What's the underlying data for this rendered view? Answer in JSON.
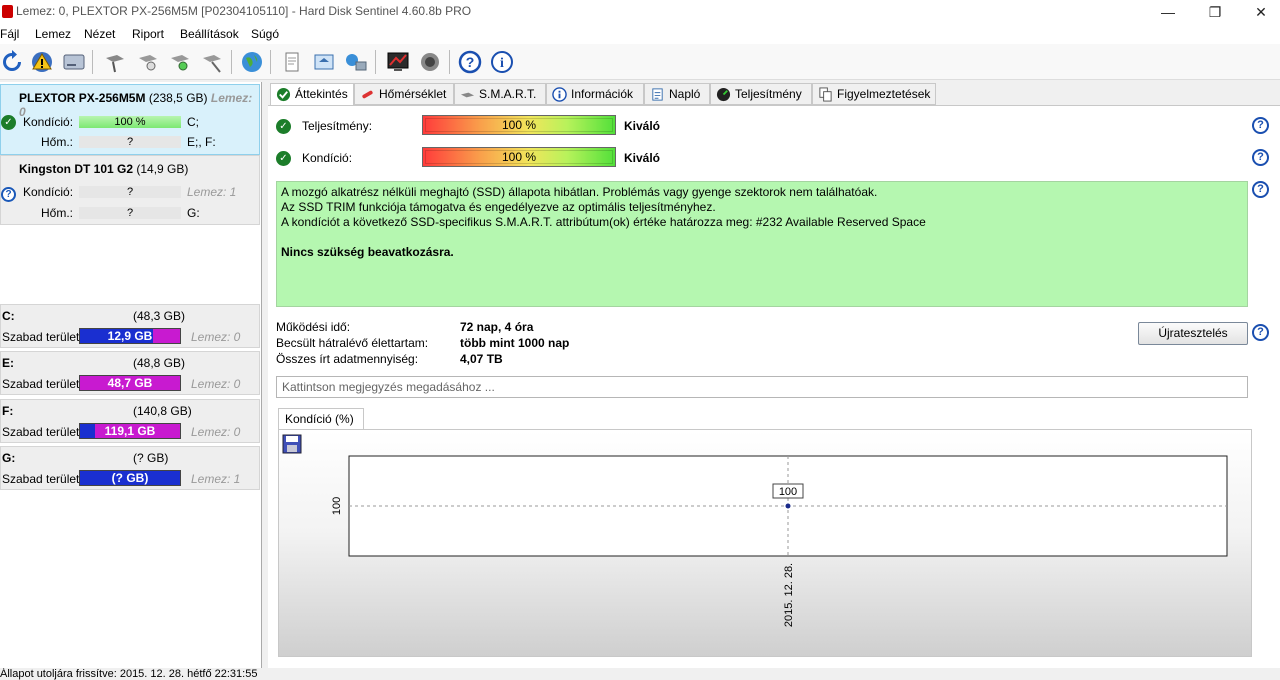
{
  "window": {
    "title": "Lemez: 0, PLEXTOR PX-256M5M [P02304105110]  -  Hard Disk Sentinel 4.60.8b PRO",
    "minimize": "—",
    "maximize": "❐",
    "close": "✕"
  },
  "menu": [
    "Fájl",
    "Lemez",
    "Nézet",
    "Riport",
    "Beállítások",
    "Súgó"
  ],
  "disks": [
    {
      "name": "PLEXTOR PX-256M5M",
      "size": "(238,5 GB)",
      "lemez": "Lemez: 0",
      "health_label": "Kondíció:",
      "health_value": "100 %",
      "health_fill": 100,
      "health_drives": "C;",
      "temp_label": "Hőm.:",
      "temp_value": "?",
      "temp_drives": "E;, F:"
    },
    {
      "name": "Kingston DT 101 G2",
      "size": "(14,9 GB)",
      "lemez": "Lemez: 1",
      "health_label": "Kondíció:",
      "health_value": "?",
      "temp_label": "Hőm.:",
      "temp_value": "?",
      "temp_drives": "G:"
    }
  ],
  "partitions": [
    {
      "name": "C:",
      "size": "(48,3 GB)",
      "label": "Szabad terület",
      "free": "12,9 GB",
      "lemez": "Lemez: 0",
      "color": "#1a2fd0"
    },
    {
      "name": "E:",
      "size": "(48,8 GB)",
      "label": "Szabad terület",
      "free": "48,7 GB",
      "lemez": "Lemez: 0",
      "color": "#c81ad0"
    },
    {
      "name": "F:",
      "size": "(140,8 GB)",
      "label": "Szabad terület",
      "free": "119,1 GB",
      "lemez": "Lemez: 0",
      "color": "#c81ad0"
    },
    {
      "name": "G:",
      "size": "(? GB)",
      "label": "Szabad terület",
      "free": "(? GB)",
      "lemez": "Lemez: 1",
      "color": "#1a2fd0"
    }
  ],
  "tabs": [
    "Áttekintés",
    "Hőmérséklet",
    "S.M.A.R.T.",
    "Információk",
    "Napló",
    "Teljesítmény",
    "Figyelmeztetések"
  ],
  "overview": {
    "perf_label": "Teljesítmény:",
    "perf_value": "100 %",
    "perf_text": "Kiváló",
    "health_label": "Kondíció:",
    "health_value": "100 %",
    "health_text": "Kiváló",
    "message_lines": [
      "A mozgó alkatrész nélküli meghajtó (SSD) állapota hibátlan. Problémás vagy gyenge szektorok nem találhatóak.",
      "Az SSD TRIM funkciója támogatva és engedélyezve az optimális teljesítményhez.",
      "A kondíciót a következő SSD-specifikus S.M.A.R.T. attribútum(ok) értéke határozza meg:  #232 Available Reserved Space"
    ],
    "message_action": "Nincs szükség beavatkozásra.",
    "uptime_label": "Működési idő:",
    "uptime_value": "72 nap, 4 óra",
    "remaining_label": "Becsült hátralévő élettartam:",
    "remaining_value": "több mint 1000 nap",
    "written_label": "Összes írt adatmennyiség:",
    "written_value": "4,07 TB",
    "retest_button": "Újratesztelés",
    "note_placeholder": "Kattintson megjegyzés megadásához ..."
  },
  "chart_data": {
    "type": "line",
    "tab_label": "Kondíció  (%)",
    "x": [
      "2015. 12. 28."
    ],
    "series": [
      {
        "values": [
          100
        ]
      }
    ],
    "point_label": "100",
    "ytick": "100",
    "xtick": "2015. 12. 28."
  },
  "status": "Állapot utoljára frissítve: 2015. 12. 28. hétfő 22:31:55"
}
